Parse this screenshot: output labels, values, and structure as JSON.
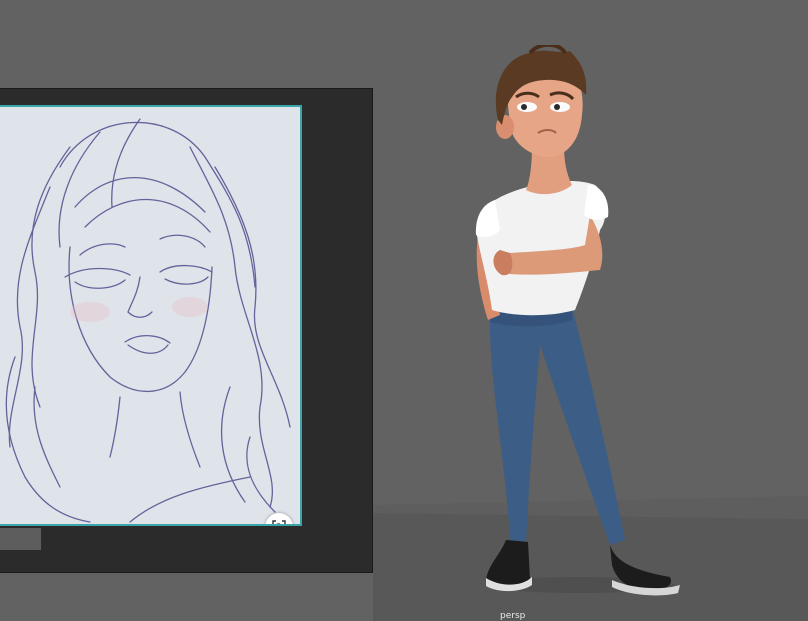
{
  "viewport": {
    "camera_label": "persp",
    "background_color": "#626262",
    "floor_color": "#585858"
  },
  "reference_panel": {
    "frame_color": "#3aa5ab",
    "lens_icon": "visual-search-icon"
  },
  "character": {
    "shirt_color": "#ffffff",
    "jeans_color": "#3c5d86",
    "hair_color": "#5a3a22",
    "shoes_color": "#1c1c1c"
  }
}
